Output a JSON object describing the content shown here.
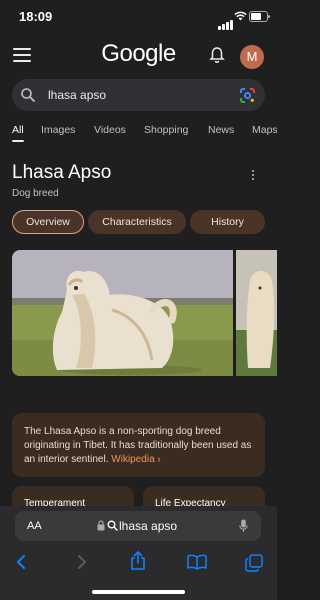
{
  "status_bar": {
    "time": "18:09"
  },
  "header": {
    "logo": "Google",
    "avatar_letter": "M"
  },
  "search": {
    "query": "lhasa apso"
  },
  "tabs": [
    {
      "label": "All"
    },
    {
      "label": "Images"
    },
    {
      "label": "Videos"
    },
    {
      "label": "Shopping"
    },
    {
      "label": "News"
    },
    {
      "label": "Maps"
    }
  ],
  "knowledge_panel": {
    "title": "Lhasa Apso",
    "subtitle": "Dog breed",
    "chips": [
      {
        "label": "Overview"
      },
      {
        "label": "Characteristics"
      },
      {
        "label": "History"
      }
    ],
    "description": "The Lhasa Apso is a non-sporting dog breed originating in Tibet. It has traditionally been used as an interior sentinel.",
    "source_link": "Wikipedia ›",
    "cards": [
      {
        "label": "Temperament"
      },
      {
        "label": "Life Expectancy"
      }
    ]
  },
  "browser": {
    "text_size": "AA",
    "url": "lhasa apso"
  },
  "colors": {
    "background": "#1f1f1f",
    "chip": "#4a3427",
    "card": "#3b2c22",
    "link": "#f0935a",
    "toolbar_icons": "#0a84ff"
  }
}
